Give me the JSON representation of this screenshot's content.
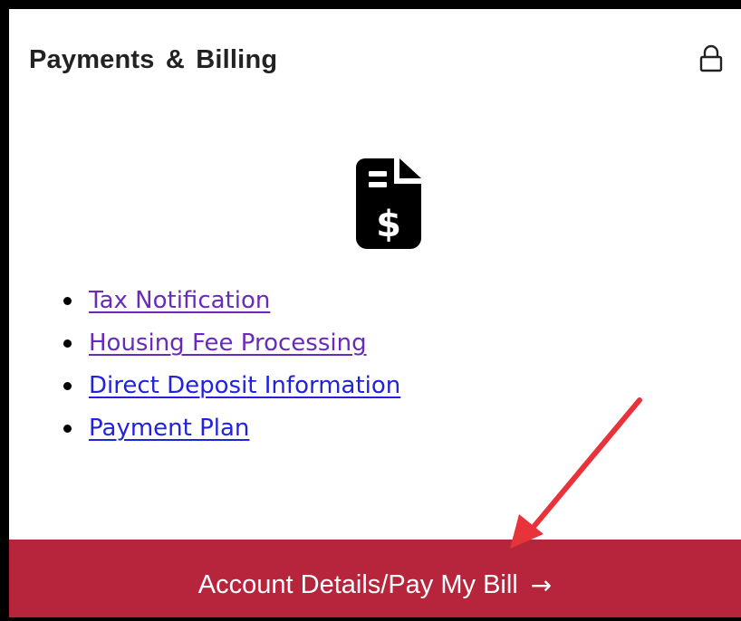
{
  "card": {
    "title": "Payments & Billing",
    "lock_icon": "lock-icon",
    "document_icon": "invoice-dollar-icon"
  },
  "links": [
    {
      "label": "Tax Notification"
    },
    {
      "label": "Housing Fee Processing"
    },
    {
      "label": "Direct Deposit Information"
    },
    {
      "label": "Payment Plan"
    }
  ],
  "cta": {
    "label": "Account Details/Pay My Bill",
    "arrow": "→"
  },
  "annotation": {
    "arrow_icon": "red-pointer-arrow",
    "color": "#e8333a"
  },
  "colors": {
    "cta_background": "#b7253d",
    "link_visited": "#6a2bbd",
    "link": "#2222dd",
    "title": "#222222"
  }
}
